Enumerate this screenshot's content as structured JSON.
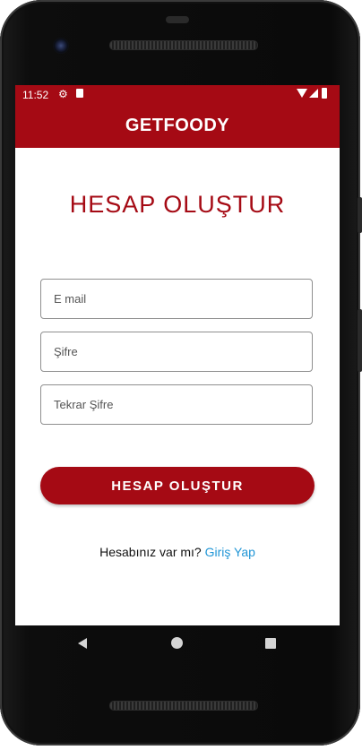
{
  "status_bar": {
    "time": "11:52",
    "icons": [
      "gear-icon",
      "sd-card-icon",
      "wifi-icon",
      "signal-icon",
      "battery-icon"
    ],
    "background_color": "#a50a14"
  },
  "app_bar": {
    "title": "GETFOODY"
  },
  "form": {
    "heading": "HESAP OLUŞTUR",
    "email_placeholder": "E mail",
    "password_placeholder": "Şifre",
    "password_repeat_placeholder": "Tekrar Şifre",
    "submit_label": "HESAP OLUŞTUR"
  },
  "login_prompt": {
    "question": "Hesabınız var mı?",
    "link_label": "Giriş Yap"
  },
  "colors": {
    "brand": "#a50a14",
    "link": "#2196d6"
  }
}
